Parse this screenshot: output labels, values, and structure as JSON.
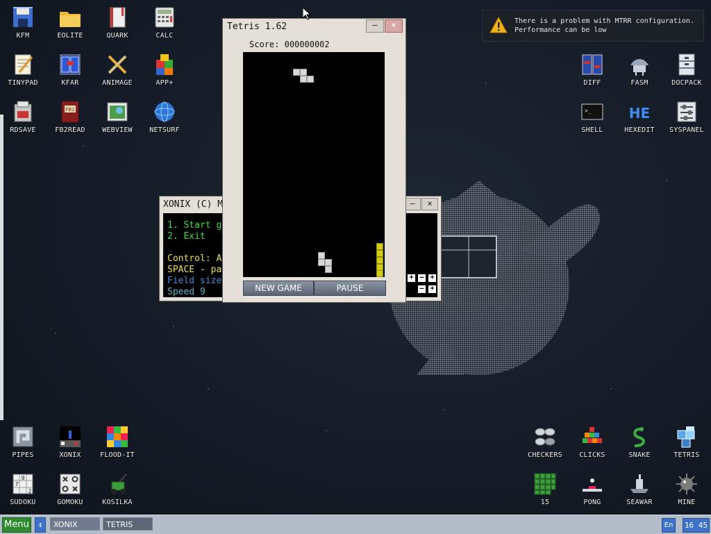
{
  "desktop": {
    "icons_left": [
      {
        "id": "kfm",
        "label": "KFM"
      },
      {
        "id": "eolite",
        "label": "EOLITE"
      },
      {
        "id": "quark",
        "label": "QUARK"
      },
      {
        "id": "calc",
        "label": "CALC"
      },
      {
        "id": "tinypad",
        "label": "TINYPAD"
      },
      {
        "id": "kfar",
        "label": "KFAR"
      },
      {
        "id": "animage",
        "label": "ANIMAGE"
      },
      {
        "id": "app",
        "label": "APP+"
      },
      {
        "id": "rdsave",
        "label": "RDSAVE"
      },
      {
        "id": "fb2read",
        "label": "FB2READ"
      },
      {
        "id": "webview",
        "label": "WEBVIEW"
      },
      {
        "id": "netsurf",
        "label": "NETSURF"
      }
    ],
    "icons_right": [
      {
        "id": "diff",
        "label": "DIFF"
      },
      {
        "id": "fasm",
        "label": "FASM"
      },
      {
        "id": "docpack",
        "label": "DOCPACK"
      },
      {
        "id": "shell",
        "label": "SHELL"
      },
      {
        "id": "hexedit",
        "label": "HEXEDIT"
      },
      {
        "id": "syspanel",
        "label": "SYSPANEL"
      }
    ],
    "icons_bottom_left": [
      {
        "id": "pipes",
        "label": "PIPES"
      },
      {
        "id": "xonix",
        "label": "XONIX"
      },
      {
        "id": "floodit",
        "label": "FLOOD-IT"
      },
      {
        "id": "sudoku",
        "label": "SUDOKU"
      },
      {
        "id": "gomoku",
        "label": "GOMOKU"
      },
      {
        "id": "kosilka",
        "label": "KOSILKA"
      }
    ],
    "icons_bottom_right": [
      {
        "id": "checkers",
        "label": "CHECKERS"
      },
      {
        "id": "clicks",
        "label": "CLICKS"
      },
      {
        "id": "snake",
        "label": "SNAKE"
      },
      {
        "id": "tetris",
        "label": "TETRIS"
      },
      {
        "id": "fifteen",
        "label": "15"
      },
      {
        "id": "pong",
        "label": "PONG"
      },
      {
        "id": "seawar",
        "label": "SEAWAR"
      },
      {
        "id": "mine",
        "label": "MINE"
      }
    ],
    "sudoku_digits": [
      "9",
      "7",
      "2"
    ],
    "fb2_badge": "FB2",
    "hexedit_mark": "HE"
  },
  "notification": {
    "line1": "There is a problem with MTRR configuration.",
    "line2": "Performance can be low"
  },
  "xonix_window": {
    "title": "XONIX (C) M",
    "minimize": "–",
    "close": "×",
    "lines": [
      {
        "text": "1. Start g",
        "color": "#3ddc3d"
      },
      {
        "text": "2. Exit",
        "color": "#3ddc3d"
      },
      {
        "text": "Control: A",
        "color": "#e8e04a"
      },
      {
        "text": "SPACE - pa",
        "color": "#e8e04a"
      },
      {
        "text": "Field size",
        "color": "#3f8fd6"
      },
      {
        "text": "Speed 9",
        "color": "#58b7c9"
      }
    ],
    "plus": "+",
    "minus": "–"
  },
  "tetris_window": {
    "title": "Tetris 1.62",
    "minimize": "–",
    "close": "×",
    "score_label": "Score:",
    "score_value": "000000002",
    "new_game": "NEW GAME",
    "pause": "PAUSE"
  },
  "taskbar": {
    "menu": "Menu",
    "switch_glyph": "↕",
    "tasks": [
      {
        "label": "XONIX",
        "active": false
      },
      {
        "label": "TETRIS",
        "active": true
      }
    ],
    "lang": "En",
    "clock": "16 45"
  }
}
